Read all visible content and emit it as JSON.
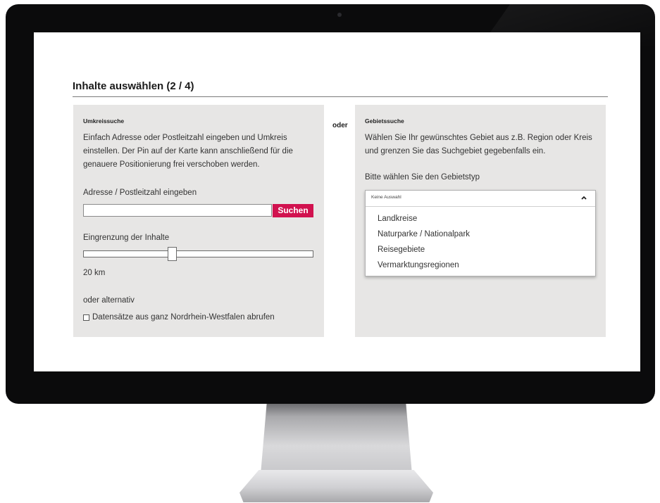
{
  "page": {
    "title": "Inhalte auswählen (2 / 4)",
    "separator": "oder"
  },
  "umkreis": {
    "heading": "Umkreissuche",
    "description": "Einfach Adresse oder Postleitzahl eingeben und Umkreis einstellen. Der Pin auf der Karte kann anschließend für die genauere Positionierung frei verschoben werden.",
    "address_label": "Adresse / Postleitzahl eingeben",
    "address_value": "",
    "search_label": "Suchen",
    "range_label": "Eingrenzung der Inhalte",
    "range_value": "20 km",
    "range_fraction": 0.38,
    "alt_label": "oder alternativ",
    "checkbox_label": "Datensätze aus ganz Nordrhein-Westfalen abrufen",
    "checkbox_checked": false
  },
  "gebiet": {
    "heading": "Gebietssuche",
    "description": "Wählen Sie Ihr gewünschtes Gebiet aus z.B. Region oder Kreis und grenzen Sie das Suchgebiet gegebenfalls ein.",
    "type_label": "Bitte wählen Sie den Gebietstyp",
    "selected": "Keine Auswahl",
    "options": [
      "Landkreise",
      "Naturparke / Nationalpark",
      "Reisegebiete",
      "Vermarktungsregionen"
    ]
  },
  "colors": {
    "accent": "#d1124f",
    "panel": "#e7e6e5"
  },
  "icons": {
    "dropdown": "chevron-up-icon",
    "checkbox": "checkbox-icon"
  }
}
